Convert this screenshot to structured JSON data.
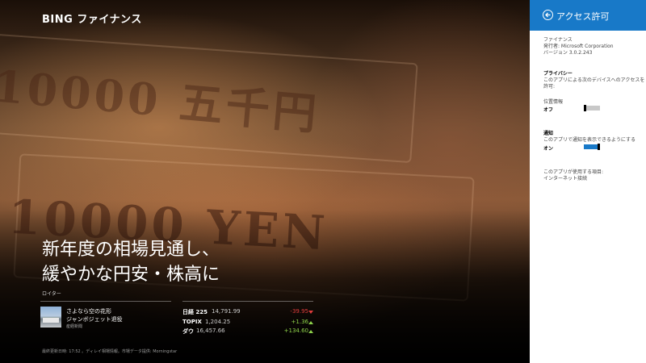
{
  "app": {
    "title": "BING ファイナンス"
  },
  "hero": {
    "headline_line1": "新年度の相場見通し、",
    "headline_line2": "緩やかな円安・株高に",
    "source": "ロイター",
    "note_upper": "10000 五千円",
    "note_lower": "10000 YEN"
  },
  "news": {
    "line1": "さよなら空の花形",
    "line2": "ジャンボジェット退役",
    "publisher": "産経新聞"
  },
  "markets": [
    {
      "name": "日経 225",
      "value": "14,791.99",
      "change": "-39.95",
      "direction": "down"
    },
    {
      "name": "TOPIX",
      "value": "1,204.25",
      "change": "+1.36",
      "direction": "up"
    },
    {
      "name": "ダウ",
      "value": "16,457.66",
      "change": "+134.60",
      "direction": "up"
    }
  ],
  "footer": {
    "text": "最終更新日時: 17:52 。ディレイ相場情報。市場データ提供: Morningstar"
  },
  "panel": {
    "title": "アクセス許可",
    "app_name": "ファイナンス",
    "publisher": "発行者: Microsoft Corporation",
    "version": "バージョン 3.0.2.243",
    "privacy_heading": "プライバシー",
    "privacy_desc_line1": "このアプリによる次のデバイスへのアクセスを",
    "privacy_desc_line2": "許可:",
    "location_label": "位置情報",
    "location_state": "オフ",
    "location_on": false,
    "notify_heading": "通知",
    "notify_desc": "このアプリで通知を表示できるようにする",
    "notify_state": "オン",
    "notify_on": true,
    "uses_label": "このアプリが使用する項目:",
    "uses_item": "インターネット接続"
  },
  "colors": {
    "accent": "#1879c8",
    "up": "#8ed24a",
    "down": "#e03c3c"
  }
}
